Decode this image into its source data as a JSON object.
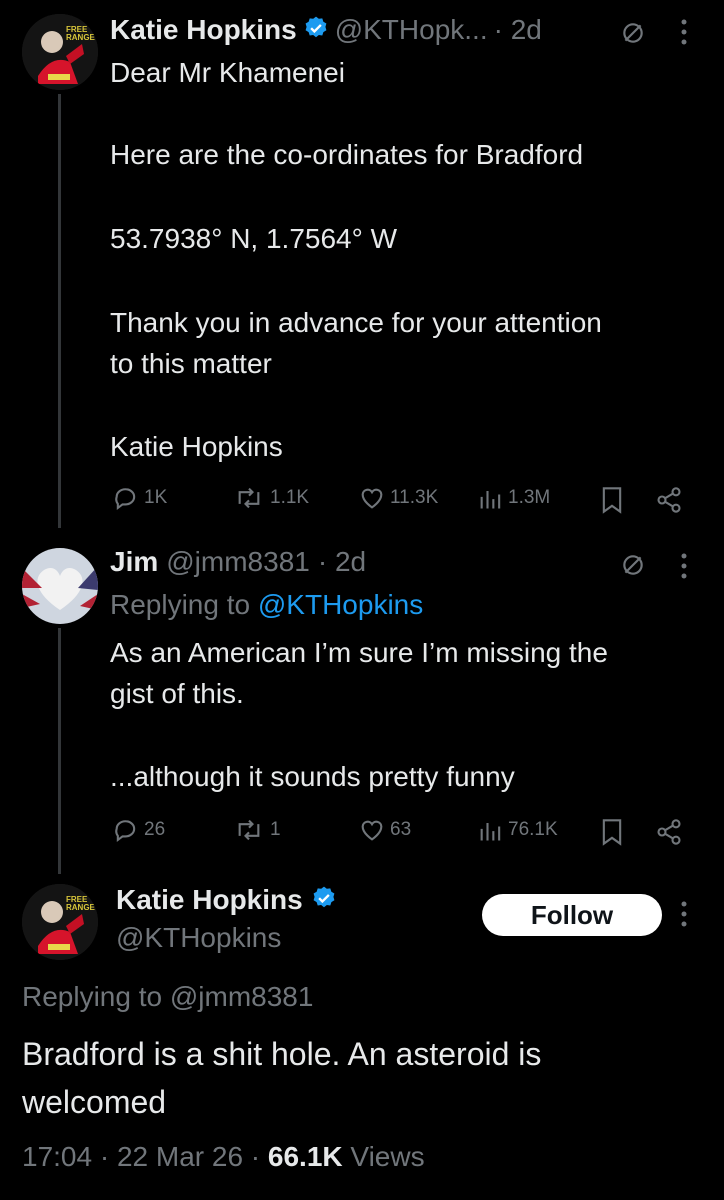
{
  "tweet1": {
    "name": "Katie Hopkins",
    "handle": "@KTHopk...",
    "time": "· 2d",
    "avatar_text": "FREE RANGE",
    "body_p1": "Dear Mr Khamenei",
    "body_p2": "Here are the co-ordinates for Bradford",
    "body_p3": "53.7938° N, 1.7564° W",
    "body_p4": "Thank you in advance for your attention\nto this matter",
    "body_p5": "Katie Hopkins",
    "stats": {
      "replies": "1K",
      "reposts": "1.1K",
      "likes": "11.3K",
      "views": "1.3M"
    }
  },
  "tweet2": {
    "name": "Jim",
    "handle": "@jmm8381",
    "time": "· 2d",
    "replying_prefix": "Replying to",
    "replying_handle": "@KTHopkins",
    "body_p1": "As an American I’m sure I’m missing the\ngist of this.",
    "body_p2": "...although it sounds pretty funny",
    "stats": {
      "replies": "26",
      "reposts": "1",
      "likes": "63",
      "views": "76.1K"
    }
  },
  "tweet3": {
    "name": "Katie Hopkins",
    "handle": "@KTHopkins",
    "avatar_text": "FREE RANGE",
    "follow_label": "Follow",
    "replying_text": "Replying to @jmm8381",
    "body": "Bradford is a shit hole. An asteroid is\nwelcomed",
    "time": "17:04 · 22 Mar 26 ·",
    "views_count": "66.1K",
    "views_label": "Views"
  },
  "icons": {
    "verified": "verified-badge-icon",
    "community": "community-note-icon",
    "more": "more-icon",
    "reply": "reply-icon",
    "repost": "repost-icon",
    "like": "like-icon",
    "views": "views-icon",
    "bookmark": "bookmark-icon",
    "share": "share-icon"
  },
  "colors": {
    "background": "#000000",
    "text": "#e7e9ea",
    "muted": "#71767b",
    "link": "#1d9bf0",
    "verified": "#1d9bf0"
  }
}
